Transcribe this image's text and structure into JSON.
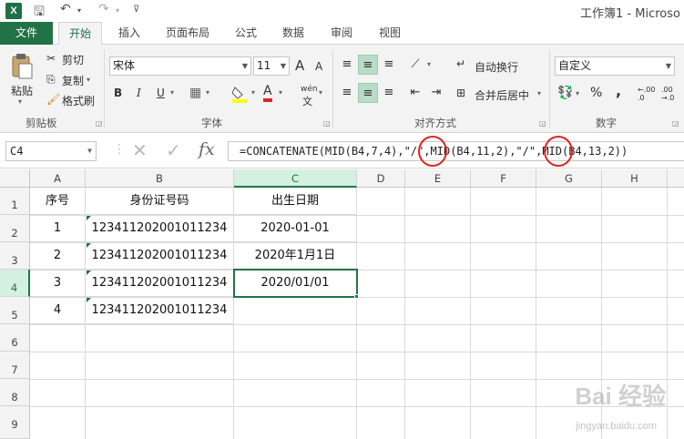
{
  "window": {
    "title": "工作簿1 - Microso"
  },
  "ribbon_tabs": [
    "文件",
    "开始",
    "插入",
    "页面布局",
    "公式",
    "数据",
    "审阅",
    "视图"
  ],
  "clipboard": {
    "paste": "粘贴",
    "cut": "剪切",
    "copy": "复制",
    "format_painter": "格式刷",
    "group": "剪贴板"
  },
  "font": {
    "name": "宋体",
    "size": "11",
    "group": "字体",
    "bold": "B",
    "italic": "I",
    "underline": "U",
    "grow": "A",
    "shrink": "A",
    "color_a": "A",
    "phonetic": "wén"
  },
  "alignment": {
    "wrap_text": "自动换行",
    "merge_center": "合并后居中",
    "group": "对齐方式"
  },
  "number": {
    "format": "自定义",
    "group": "数字",
    "percent": "%",
    "comma": ",",
    "inc_dec": "←.00 .0",
    "dec_dec": ".00 →.0"
  },
  "formula_bar": {
    "name_box": "C4",
    "cancel": "✕",
    "enter": "✓",
    "fx": "fx",
    "formula": "=CONCATENATE(MID(B4,7,4),\"/\",MID(B4,11,2),\"/\",MID(B4,13,2))"
  },
  "columns": [
    "A",
    "B",
    "C",
    "D",
    "E",
    "F",
    "G",
    "H"
  ],
  "rows": [
    "1",
    "2",
    "3",
    "4",
    "5",
    "6",
    "7",
    "8",
    "9"
  ],
  "cells": {
    "A1": "序号",
    "B1": "身份证号码",
    "C1": "出生日期",
    "A2": "1",
    "B2": "123411202001011234",
    "C2": "2020-01-01",
    "A3": "2",
    "B3": "123411202001011234",
    "C3": "2020年1月1日",
    "A4": "3",
    "B4": "123411202001011234",
    "C4": "2020/01/01",
    "A5": "4",
    "B5": "123411202001011234"
  },
  "watermark": {
    "brand": "Bai 经验",
    "url": "jingyan.baidu.com"
  },
  "colors": {
    "accent": "#217346",
    "highlight_ring": "#e02020"
  }
}
